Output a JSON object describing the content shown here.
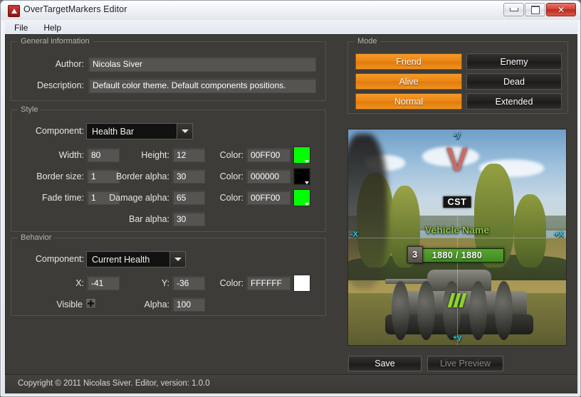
{
  "window": {
    "title": "OverTargetMarkers Editor",
    "icon": "app-icon",
    "minimize_label": "",
    "maximize_label": "",
    "close_label": "✕"
  },
  "menu": {
    "items": [
      {
        "label": "File"
      },
      {
        "label": "Help"
      }
    ]
  },
  "general_information": {
    "title": "General information",
    "author_label": "Author:",
    "author_value": "Nicolas Siver",
    "description_label": "Description:",
    "description_value": "Default color theme. Default components positions."
  },
  "style": {
    "title": "Style",
    "component_label": "Component:",
    "component_value": "Health Bar",
    "width_label": "Width:",
    "width_value": "80",
    "height_label": "Height:",
    "height_value": "12",
    "color1_label": "Color:",
    "color1_value": "00FF00",
    "color1_hex": "#00FF00",
    "border_size_label": "Border size:",
    "border_size_value": "1",
    "border_alpha_label": "Border alpha:",
    "border_alpha_value": "30",
    "color2_label": "Color:",
    "color2_value": "000000",
    "color2_hex": "#000000",
    "fade_time_label": "Fade time:",
    "fade_time_value": "1",
    "damage_alpha_label": "Damage alpha:",
    "damage_alpha_value": "65",
    "color3_label": "Color:",
    "color3_value": "00FF00",
    "color3_hex": "#00FF00",
    "bar_alpha_label": "Bar alpha:",
    "bar_alpha_value": "30"
  },
  "behavior": {
    "title": "Behavior",
    "component_label": "Component:",
    "component_value": "Current Health",
    "x_label": "X:",
    "x_value": "-41",
    "y_label": "Y:",
    "y_value": "-36",
    "color_label": "Color:",
    "color_value": "FFFFFF",
    "color_hex": "#FFFFFF",
    "visible_label": "Visible",
    "visible_checked": "✔",
    "alpha_label": "Alpha:",
    "alpha_value": "100"
  },
  "mode": {
    "title": "Mode",
    "accent_on": "#ee8a13",
    "buttons": [
      {
        "label": "Friend",
        "active": true
      },
      {
        "label": "Enemy",
        "active": false
      },
      {
        "label": "Alive",
        "active": true
      },
      {
        "label": "Dead",
        "active": false
      },
      {
        "label": "Normal",
        "active": true
      },
      {
        "label": "Extended",
        "active": false
      }
    ]
  },
  "preview": {
    "marker_arrow": "V",
    "clan_tag": "CST",
    "vehicle_name": "Vehicle Name",
    "health_text": "1880 / 1880",
    "rank": "3",
    "axis_minus_y": "-y",
    "axis_plus_y": "+y",
    "axis_minus_x": "-X",
    "axis_plus_x": "+X",
    "health_color": "#4f9c28",
    "name_color": "#8ec04a",
    "axis_color": "#35c8e0"
  },
  "actions": {
    "save_label": "Save",
    "live_preview_label": "Live Preview"
  },
  "status": {
    "text": "Copyright © 2011 Nicolas Siver. Editor, version: 1.0.0"
  }
}
